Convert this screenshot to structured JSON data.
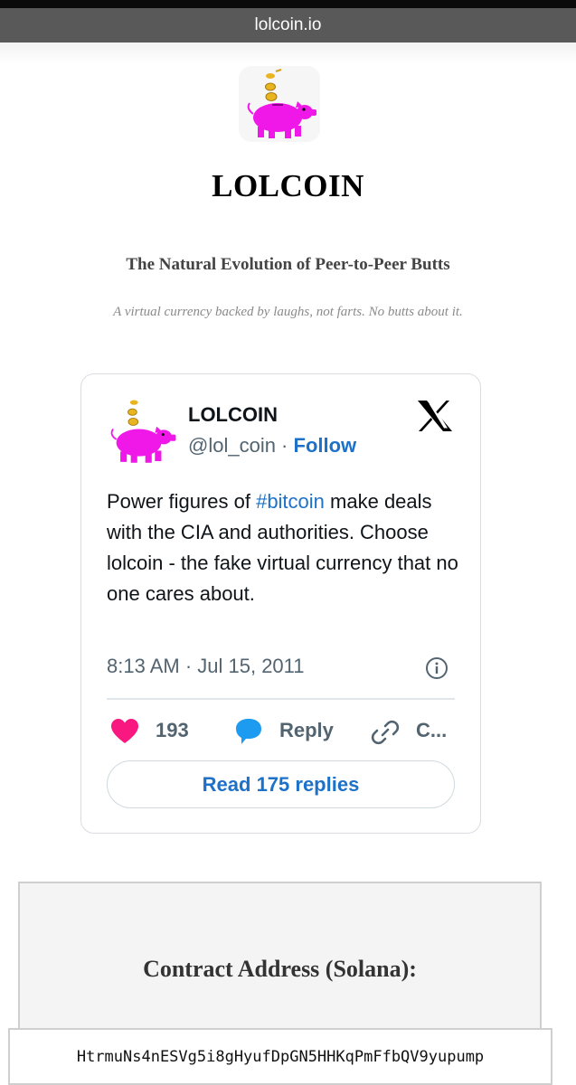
{
  "browser": {
    "url": "lolcoin.io"
  },
  "site": {
    "title": "LOLCOIN",
    "tagline": "The Natural Evolution of Peer-to-Peer Butts",
    "subtitle": "A virtual currency backed by laughs, not farts. No butts about it.",
    "logo_icon": "piggy-bank-icon"
  },
  "tweet": {
    "author_name": "LOLCOIN",
    "handle": "@lol_coin",
    "separator": " · ",
    "follow_label": "Follow",
    "text_before": "Power figures of ",
    "hashtag": "#bitcoin",
    "text_after": " make deals with the CIA and authorities. Choose lolcoin - the fake virtual currency that no one cares about.",
    "timestamp": "8:13 AM · Jul 15, 2011",
    "likes": "193",
    "reply_label": "Reply",
    "copy_label": "C...",
    "read_replies_label": "Read 175 replies",
    "colors": {
      "link": "#1d71c9",
      "heart": "#f91880",
      "reply_icon": "#1d9bf0"
    }
  },
  "contract": {
    "title": "Contract Address (Solana):",
    "address": "HtrmuNs4nESVg5i8gHyufDpGN5HHKqPmFfbQV9yupump"
  }
}
